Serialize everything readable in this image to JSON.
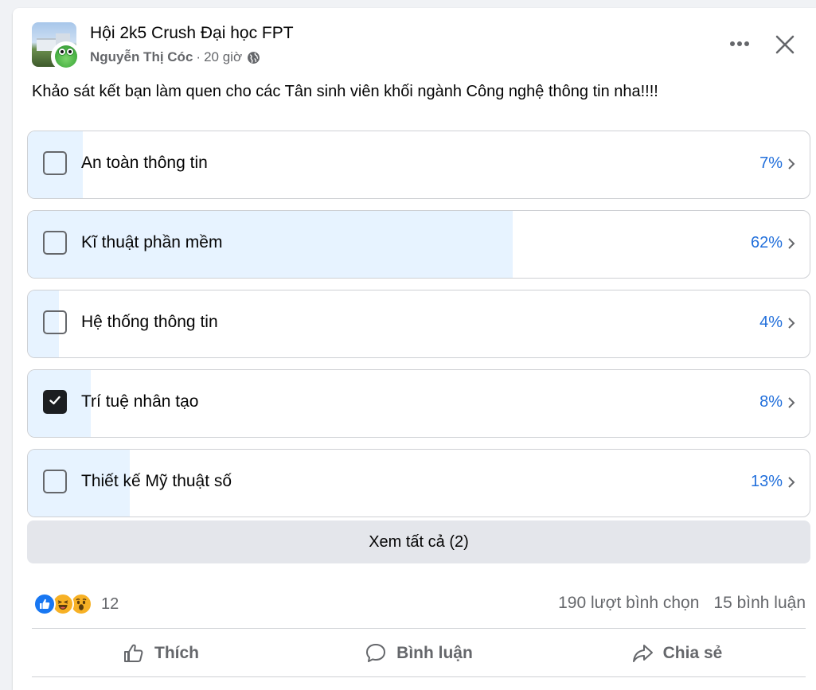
{
  "post": {
    "group_name": "Hội 2k5 Crush Đại học FPT",
    "author": "Nguyễn Thị Cóc",
    "separator": "·",
    "time": "20 giờ",
    "text": "Khảo sát kết bạn làm quen cho các Tân sinh viên khối ngành Công nghệ thông tin nha!!!!"
  },
  "poll": {
    "options": [
      {
        "label": "An toàn thông tin",
        "percent_text": "7%",
        "percent": 7,
        "checked": false
      },
      {
        "label": "Kĩ thuật phần mềm",
        "percent_text": "62%",
        "percent": 62,
        "checked": false
      },
      {
        "label": "Hệ thống thông tin",
        "percent_text": "4%",
        "percent": 4,
        "checked": false
      },
      {
        "label": "Trí tuệ nhân tạo",
        "percent_text": "8%",
        "percent": 8,
        "checked": true
      },
      {
        "label": "Thiết kế Mỹ thuật số",
        "percent_text": "13%",
        "percent": 13,
        "checked": false
      }
    ],
    "see_all_label": "Xem tất cả (2)"
  },
  "footer": {
    "reaction_icons": [
      "like-icon",
      "haha-icon",
      "wow-icon"
    ],
    "reaction_count": "12",
    "votes_text": "190 lượt bình chọn",
    "comments_text": "15 bình luận"
  },
  "actions": {
    "like_label": "Thích",
    "comment_label": "Bình luận",
    "share_label": "Chia sẻ"
  },
  "colors": {
    "accent": "#216fdb",
    "fill": "#e7f3ff",
    "muted": "#65676b"
  }
}
